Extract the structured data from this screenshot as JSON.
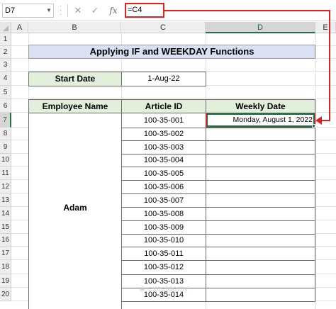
{
  "formula_bar": {
    "name_box": "D7",
    "dropdown_glyph": "▼",
    "cancel_glyph": "✕",
    "enter_glyph": "✓",
    "fx_label": "fx",
    "formula": "=C4"
  },
  "columns": [
    "A",
    "B",
    "C",
    "D",
    "E"
  ],
  "selected_column": "D",
  "rows": [
    "1",
    "2",
    "3",
    "4",
    "5",
    "6",
    "7",
    "8",
    "9",
    "10",
    "11",
    "12",
    "13",
    "14",
    "15",
    "16",
    "17",
    "18",
    "19",
    "20"
  ],
  "selected_row": "7",
  "sheet": {
    "title": "Applying IF and WEEKDAY Functions",
    "start_date_label": "Start Date",
    "start_date_value": "1-Aug-22",
    "headers": {
      "employee": "Employee Name",
      "article": "Article ID",
      "weekly": "Weekly Date"
    },
    "employee_name": "Adam",
    "article_ids": [
      "100-35-001",
      "100-35-002",
      "100-35-003",
      "100-35-004",
      "100-35-005",
      "100-35-006",
      "100-35-007",
      "100-35-008",
      "100-35-009",
      "100-35-010",
      "100-35-011",
      "100-35-012",
      "100-35-013",
      "100-35-014"
    ],
    "first_weekly_date": "Monday, August 1, 2022"
  },
  "watermark": "exceldemy",
  "colors": {
    "title_fill": "#d9e1f2",
    "header_fill": "#e2efda",
    "highlight": "#e02020",
    "selection": "#217346"
  }
}
